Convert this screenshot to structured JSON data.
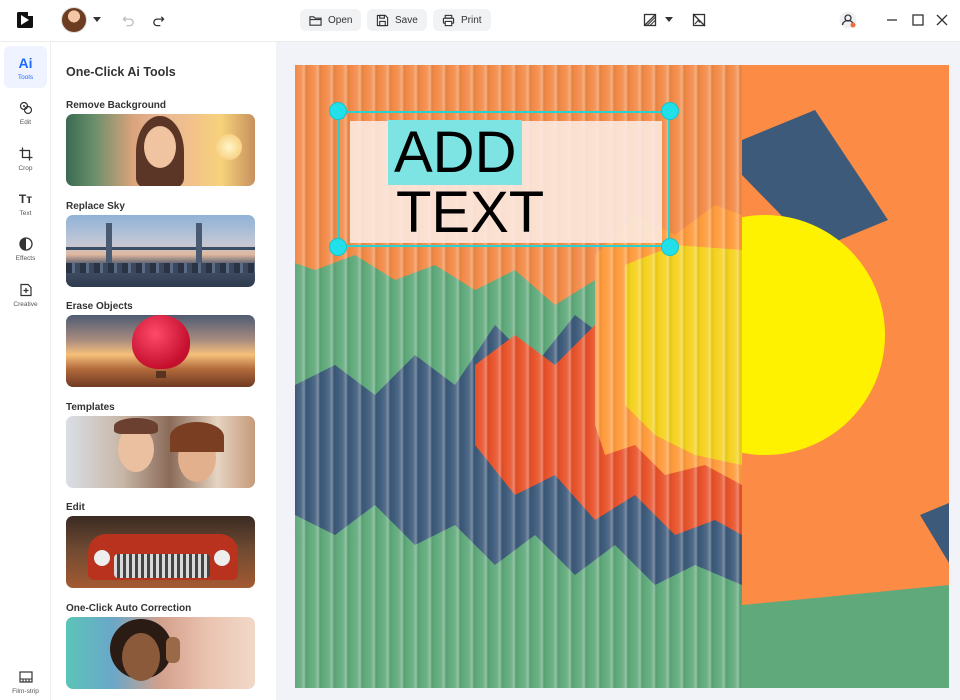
{
  "toolbar": {
    "open_label": "Open",
    "save_label": "Save",
    "print_label": "Print"
  },
  "rail": {
    "items": [
      {
        "label": "Tools",
        "glyph": "Ai",
        "active": true
      },
      {
        "label": "Edit"
      },
      {
        "label": "Crop"
      },
      {
        "label": "Text",
        "glyph": "Tт"
      },
      {
        "label": "Effects"
      },
      {
        "label": "Creative"
      }
    ],
    "bottom": {
      "label": "Film-strip"
    }
  },
  "panel": {
    "title": "One-Click Ai Tools",
    "tools": [
      {
        "label": "Remove Background"
      },
      {
        "label": "Replace Sky"
      },
      {
        "label": "Erase Objects"
      },
      {
        "label": "Templates"
      },
      {
        "label": "Edit"
      },
      {
        "label": "One-Click Auto Correction"
      }
    ]
  },
  "canvas": {
    "text_line1": "ADD",
    "text_line2": "TEXT",
    "colors": {
      "orange": "#fb8b45",
      "deep_orange": "#e8522a",
      "green": "#5fa97a",
      "navy": "#3d5a7a",
      "yellow": "#fff200",
      "accent": "#21e0ea"
    }
  }
}
